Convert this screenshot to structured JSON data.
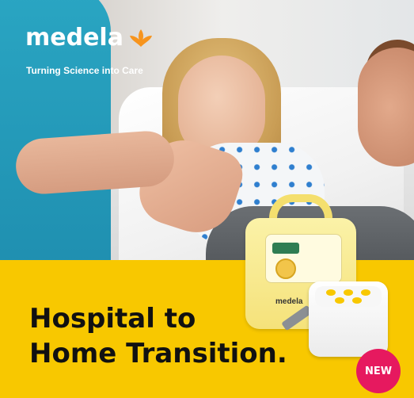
{
  "brand": {
    "name": "medela",
    "tagline": "Turning Science into Care",
    "logo_icon": "medela-flower-icon",
    "accent_color": "#f7941d"
  },
  "headline": {
    "line1": "Hospital to",
    "line2": "Home Transition."
  },
  "badge": {
    "label": "NEW",
    "color": "#e6195f"
  },
  "product": {
    "brand_label": "medela",
    "icon": "breast-pump-device-icon"
  },
  "colors": {
    "band": "#f8c800",
    "headline_text": "#111111"
  }
}
